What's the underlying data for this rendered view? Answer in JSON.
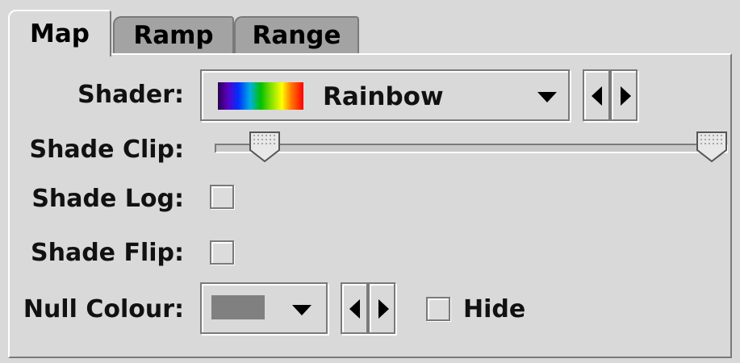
{
  "tabs": [
    {
      "label": "Map",
      "active": true
    },
    {
      "label": "Ramp",
      "active": false
    },
    {
      "label": "Range",
      "active": false
    }
  ],
  "form": {
    "shader_label": "Shader:",
    "shader_value": "Rainbow",
    "shade_clip_label": "Shade Clip:",
    "shade_clip_range": [
      0.08,
      1.0
    ],
    "shade_log_label": "Shade Log:",
    "shade_log_checked": false,
    "shade_flip_label": "Shade Flip:",
    "shade_flip_checked": false,
    "null_colour_label": "Null Colour:",
    "null_colour_value": "#808080",
    "hide_label": "Hide",
    "hide_checked": false
  },
  "icons": {
    "prev": "triangle-left-icon",
    "next": "triangle-right-icon",
    "dropdown": "triangle-down-icon"
  },
  "colors": {
    "background": "#d9d9d9",
    "rainbow": [
      "#2a0050",
      "#5a00c8",
      "#0030ff",
      "#00b0e0",
      "#00c000",
      "#80e000",
      "#ffff00",
      "#ff8000",
      "#ff0000"
    ]
  }
}
